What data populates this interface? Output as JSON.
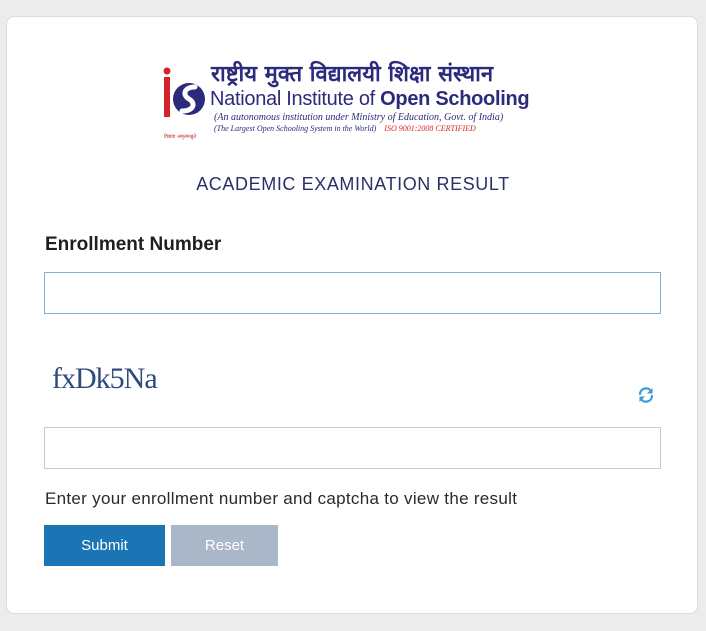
{
  "logo": {
    "hindi_name": "राष्ट्रीय मुक्त विद्यालयी शिक्षा संस्थान",
    "english_name_part1": "National Institute of ",
    "english_name_part2": "Open Schooling",
    "subtitle": "(An autonomous institution under Ministry of Education, Govt. of India)",
    "tagline": "(The Largest Open Schooling System in the World)",
    "iso": "ISO 9001:2008 CERTIFIED",
    "emblem_caption": "विद्यया अमृतमश्नुते",
    "colors": {
      "navy": "#2b2a7d",
      "red": "#d4232a"
    }
  },
  "page": {
    "heading": "ACADEMIC EXAMINATION RESULT"
  },
  "form": {
    "enrollment_label": "Enrollment Number",
    "enrollment_value": "",
    "enrollment_placeholder": "",
    "captcha_text": "fxDk5Na",
    "captcha_value": "",
    "captcha_placeholder": "",
    "refresh_icon": "refresh-icon",
    "hint": "Enter your enrollment number and captcha to view the result",
    "submit_label": "Submit",
    "reset_label": "Reset"
  },
  "colors": {
    "accent": "#1b74b4",
    "reset": "#aab7c9",
    "heading": "#2b3168",
    "refresh": "#3a9ad9"
  }
}
